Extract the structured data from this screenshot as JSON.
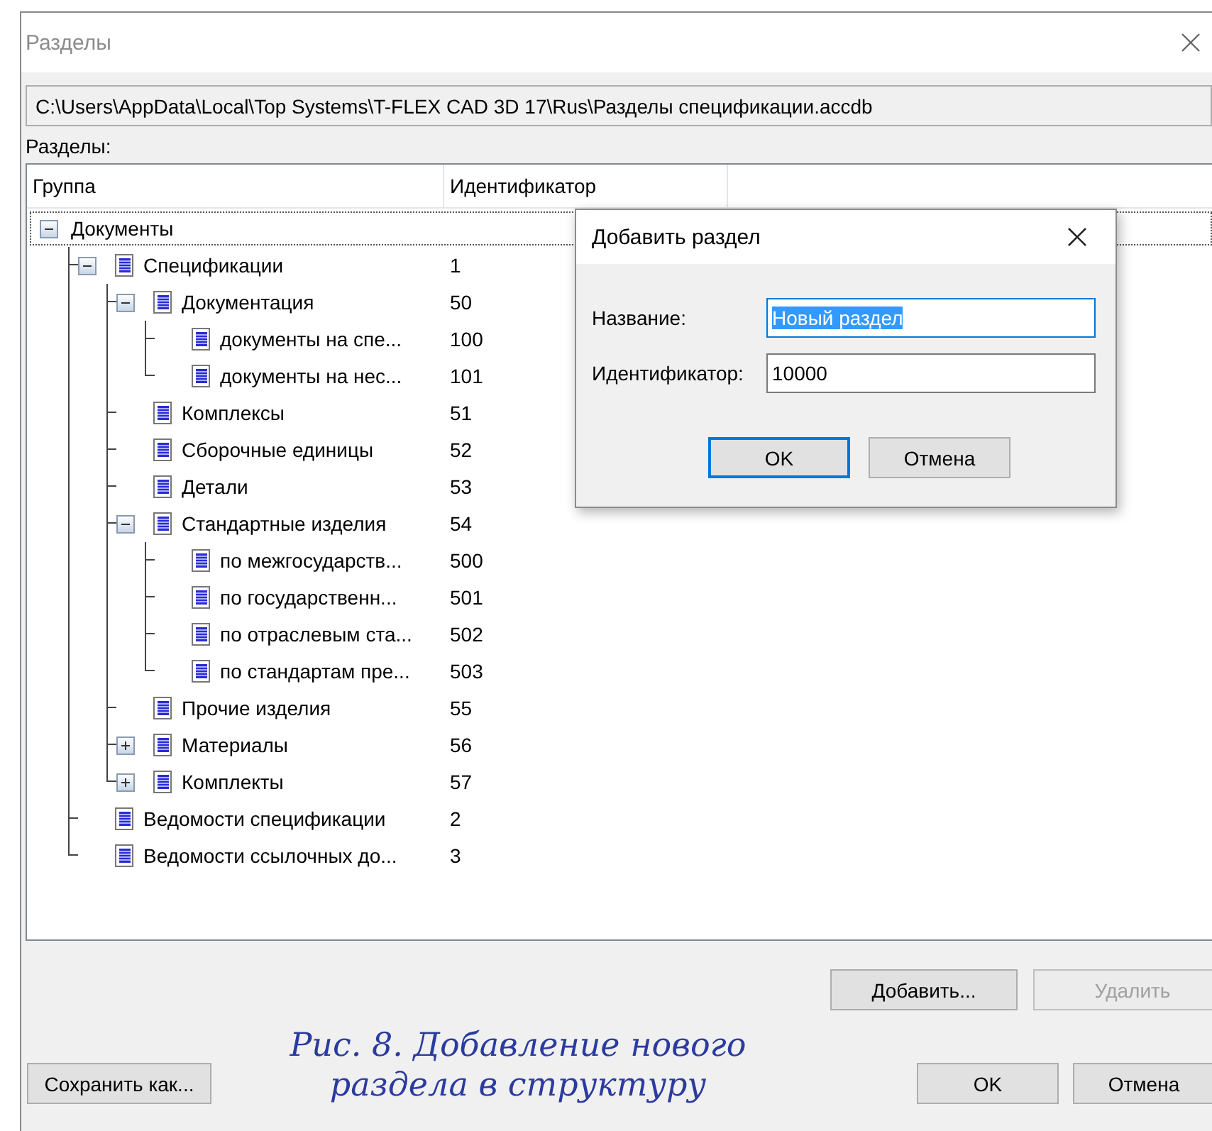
{
  "window": {
    "title": "Разделы"
  },
  "path_field": {
    "value": "C:\\Users\\AppData\\Local\\Top Systems\\T-FLEX CAD 3D 17\\Rus\\Разделы спецификации.accdb"
  },
  "sections_label": "Разделы:",
  "table": {
    "columns": [
      "Группа",
      "Идентификатор"
    ],
    "rows": [
      {
        "kind": "root",
        "name": "Документы",
        "id": "",
        "focused": true,
        "expanded": true,
        "children": [
          {
            "kind": "section",
            "name": "Спецификации",
            "id": "1",
            "focused": false,
            "expanded": true,
            "children": [
              {
                "kind": "section",
                "name": "Документация",
                "id": "50",
                "focused": false,
                "expanded": true,
                "children": [
                  {
                    "kind": "section",
                    "name": "документы на спе...",
                    "id": "100",
                    "focused": false
                  },
                  {
                    "kind": "section",
                    "name": "документы на нес...",
                    "id": "101",
                    "focused": false
                  }
                ]
              },
              {
                "kind": "section",
                "name": "Комплексы",
                "id": "51",
                "focused": false
              },
              {
                "kind": "section",
                "name": "Сборочные единицы",
                "id": "52",
                "focused": false
              },
              {
                "kind": "section",
                "name": "Детали",
                "id": "53",
                "focused": false
              },
              {
                "kind": "section",
                "name": "Стандартные изделия",
                "id": "54",
                "focused": false,
                "expanded": true,
                "children": [
                  {
                    "kind": "section",
                    "name": "по межгосударств...",
                    "id": "500",
                    "focused": false
                  },
                  {
                    "kind": "section",
                    "name": "по государственн...",
                    "id": "501",
                    "focused": false
                  },
                  {
                    "kind": "section",
                    "name": "по отраслевым ста...",
                    "id": "502",
                    "focused": false
                  },
                  {
                    "kind": "section",
                    "name": "по стандартам пре...",
                    "id": "503",
                    "focused": false
                  }
                ]
              },
              {
                "kind": "section",
                "name": "Прочие изделия",
                "id": "55",
                "focused": false
              },
              {
                "kind": "section",
                "name": "Материалы",
                "id": "56",
                "focused": false,
                "expanded": false
              },
              {
                "kind": "section",
                "name": "Комплекты",
                "id": "57",
                "focused": false,
                "expanded": false
              }
            ]
          },
          {
            "kind": "section",
            "name": "Ведомости спецификации",
            "id": "2",
            "focused": false
          },
          {
            "kind": "section",
            "name": "Ведомости ссылочных до...",
            "id": "3",
            "focused": false
          }
        ]
      }
    ]
  },
  "buttons": [
    {
      "label": "Добавить...",
      "disabled": false
    },
    {
      "label": "Удалить",
      "disabled": true
    }
  ],
  "footer_buttons": [
    {
      "label": "Сохранить как..."
    },
    {
      "label": "OK"
    },
    {
      "label": "Отмена"
    }
  ],
  "dialog": {
    "title": "Добавить раздел",
    "fields": [
      {
        "label": "Название:",
        "value": "Новый раздел",
        "text_selected": true,
        "focused": true
      },
      {
        "label": "Идентификатор:",
        "value": "10000",
        "text_selected": false,
        "focused": false
      }
    ],
    "buttons": [
      {
        "label": "OK",
        "default": true
      },
      {
        "label": "Отмена",
        "default": false
      }
    ]
  },
  "caption": "Рис. 8. Добавление нового раздела в структуру"
}
